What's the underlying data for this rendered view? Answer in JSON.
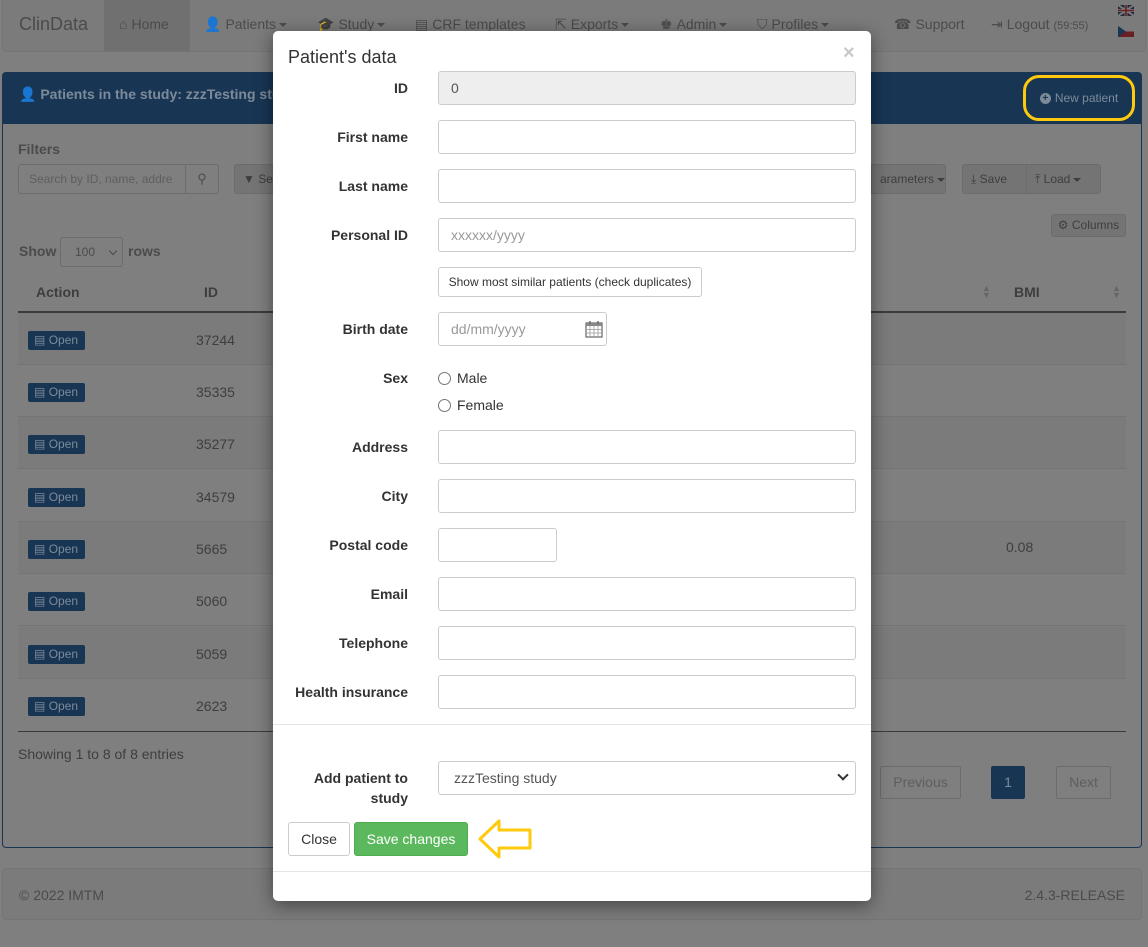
{
  "navbar": {
    "brand": "ClinData",
    "items": [
      {
        "label": "Home",
        "icon": "home-icon"
      },
      {
        "label": "Patients",
        "icon": "user-icon"
      },
      {
        "label": "Study",
        "icon": "graduation-cap-icon"
      },
      {
        "label": "CRF templates",
        "icon": "document-icon"
      },
      {
        "label": "Exports",
        "icon": "export-icon"
      },
      {
        "label": "Admin",
        "icon": "admin-icon"
      },
      {
        "label": "Profiles",
        "icon": "tags-icon"
      },
      {
        "label": "Support",
        "icon": "phone-icon"
      },
      {
        "label": "Logout",
        "icon": "logout-icon"
      }
    ],
    "logout_timer": "(59:55)",
    "languages": [
      "uk-flag-icon",
      "cz-flag-icon"
    ]
  },
  "panel": {
    "title": "Patients in the study: zzzTesting stu",
    "new_patient": "New patient",
    "filters_label": "Filters",
    "search_placeholder": "Search by ID, name, addre",
    "filter_button": "Se",
    "parameters_button": "arameters",
    "save_button": "Save",
    "load_button": "Load",
    "columns_button": "Columns",
    "show_label": "Show",
    "rows_label": "rows",
    "rows_value": "100",
    "columns": {
      "action": "Action",
      "id": "ID",
      "bmi": "BMI"
    },
    "open_label": "Open",
    "rows": [
      {
        "id": "37244",
        "bmi": ""
      },
      {
        "id": "35335",
        "bmi": ""
      },
      {
        "id": "35277",
        "bmi": ""
      },
      {
        "id": "34579",
        "bmi": ""
      },
      {
        "id": "5665",
        "bmi": "0.08"
      },
      {
        "id": "5060",
        "bmi": ""
      },
      {
        "id": "5059",
        "bmi": ""
      },
      {
        "id": "2623",
        "bmi": ""
      }
    ],
    "info": "Showing 1 to 8 of 8 entries",
    "pagination": {
      "previous": "Previous",
      "page": "1",
      "next": "Next"
    }
  },
  "footer": {
    "copyright": "© 2022 IMTM",
    "version": "2.4.3-RELEASE"
  },
  "modal": {
    "title": "Patient's data",
    "close_symbol": "×",
    "labels": {
      "id": "ID",
      "first_name": "First name",
      "last_name": "Last name",
      "personal_id": "Personal ID",
      "birth_date": "Birth date",
      "sex": "Sex",
      "address": "Address",
      "city": "City",
      "postal_code": "Postal code",
      "email": "Email",
      "telephone": "Telephone",
      "health_insurance": "Health insurance",
      "add_to_study": "Add patient to study"
    },
    "values": {
      "id": "0",
      "personal_id_placeholder": "xxxxxx/yyyy",
      "birth_date_placeholder": "dd/mm/yyyy",
      "study": "zzzTesting study"
    },
    "sex_options": [
      "Male",
      "Female"
    ],
    "duplicates_button": "Show most similar patients (check duplicates)",
    "close_button": "Close",
    "save_button": "Save changes"
  },
  "colors": {
    "primary_dim": "#183654",
    "success": "#5cb85c",
    "highlight": "#ffc90e"
  }
}
